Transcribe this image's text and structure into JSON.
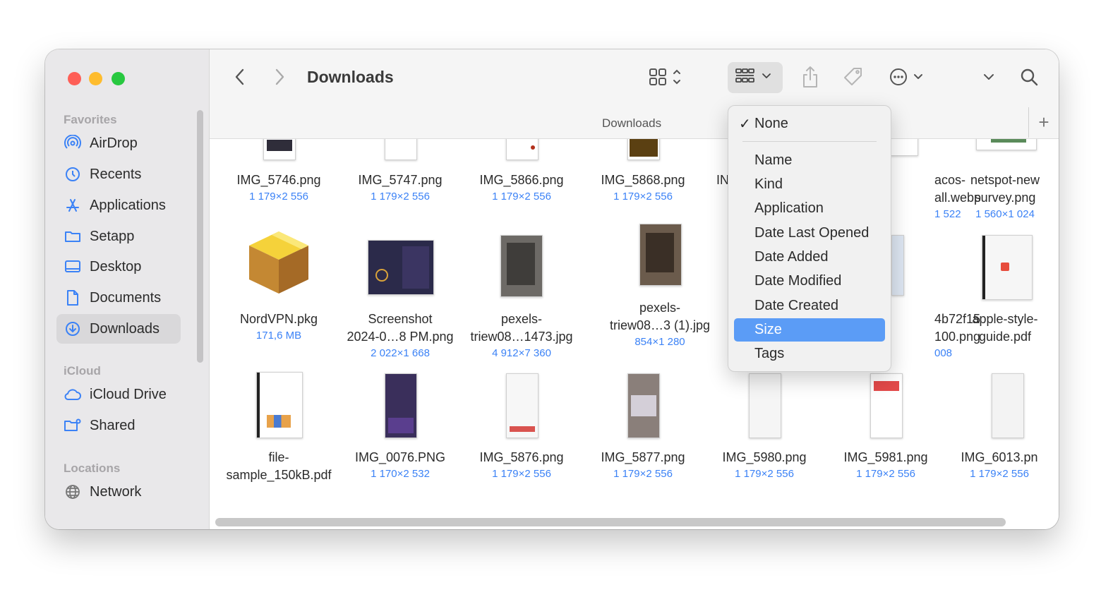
{
  "window": {
    "title": "Downloads"
  },
  "sidebar": {
    "sections": [
      {
        "label": "Favorites",
        "items": [
          {
            "label": "AirDrop",
            "icon": "airdrop-icon"
          },
          {
            "label": "Recents",
            "icon": "clock-icon"
          },
          {
            "label": "Applications",
            "icon": "applications-icon"
          },
          {
            "label": "Setapp",
            "icon": "folder-icon"
          },
          {
            "label": "Desktop",
            "icon": "desktop-icon"
          },
          {
            "label": "Documents",
            "icon": "document-icon"
          },
          {
            "label": "Downloads",
            "icon": "download-icon",
            "selected": true
          }
        ]
      },
      {
        "label": "iCloud",
        "items": [
          {
            "label": "iCloud Drive",
            "icon": "cloud-icon"
          },
          {
            "label": "Shared",
            "icon": "shared-folder-icon"
          }
        ]
      },
      {
        "label": "Locations",
        "items": [
          {
            "label": "Network",
            "icon": "globe-icon"
          }
        ]
      }
    ]
  },
  "toolbar": {
    "title": "Downloads",
    "back_icon": "chevron-left-icon",
    "forward_icon": "chevron-right-icon",
    "view_icon": "icon-grid-view-icon",
    "group_icon": "group-by-icon",
    "share_icon": "share-icon",
    "tag_icon": "tag-icon",
    "more_icon": "ellipsis-circle-icon",
    "search_icon": "search-icon"
  },
  "pathbar": {
    "label": "Downloads",
    "plus": "+"
  },
  "files": [
    {
      "name": [
        "IMG_5746.png"
      ],
      "sub": "1 179×2 556"
    },
    {
      "name": [
        "IMG_5747.png"
      ],
      "sub": "1 179×2 556"
    },
    {
      "name": [
        "IMG_5866.png"
      ],
      "sub": "1 179×2 556"
    },
    {
      "name": [
        "IMG_5868.png"
      ],
      "sub": "1 179×2 556"
    },
    {
      "name": [
        "IN"
      ],
      "sub": ""
    },
    {
      "name": [
        "acos-",
        "all.webp"
      ],
      "sub": "1 522"
    },
    {
      "name": [
        "netspot-new",
        "survey.png"
      ],
      "sub": "1 560×1 024"
    },
    {
      "name": [
        "NordVPN.pkg"
      ],
      "sub": "171,6 MB"
    },
    {
      "name": [
        "Screenshot",
        "2024-0…8 PM.png"
      ],
      "sub": "2 022×1 668"
    },
    {
      "name": [
        "pexels-",
        "triew08…1473.jpg"
      ],
      "sub": "4 912×7 360"
    },
    {
      "name": [
        "pexels-",
        "triew08…3 (1).jpg"
      ],
      "sub": "854×1 280"
    },
    {
      "name": [
        "4b72f15",
        "100.png"
      ],
      "sub": "008"
    },
    {
      "name": [
        "apple-style-",
        "guide.pdf"
      ],
      "sub": ""
    },
    {
      "name": [
        "file-",
        "sample_150kB.pdf"
      ],
      "sub": ""
    },
    {
      "name": [
        "IMG_0076.PNG"
      ],
      "sub": "1 170×2 532"
    },
    {
      "name": [
        "IMG_5876.png"
      ],
      "sub": "1 179×2 556"
    },
    {
      "name": [
        "IMG_5877.png"
      ],
      "sub": "1 179×2 556"
    },
    {
      "name": [
        "IMG_5980.png"
      ],
      "sub": "1 179×2 556"
    },
    {
      "name": [
        "IMG_5981.png"
      ],
      "sub": "1 179×2 556"
    },
    {
      "name": [
        "IMG_6013.pn"
      ],
      "sub": "1 179×2 556"
    }
  ],
  "group_menu": {
    "checked": "None",
    "checkmark": "✓",
    "items": [
      "Name",
      "Kind",
      "Application",
      "Date Last Opened",
      "Date Added",
      "Date Modified",
      "Date Created",
      "Size",
      "Tags"
    ],
    "highlighted": "Size"
  }
}
